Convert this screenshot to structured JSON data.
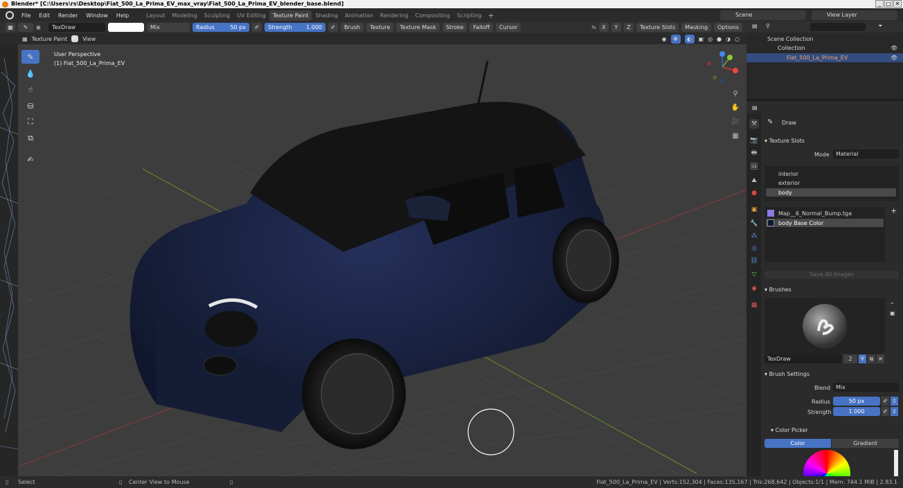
{
  "window": {
    "title": "Blender* [C:\\Users\\rs\\Desktop\\Fiat_500_La_Prima_EV_max_vray\\Fiat_500_La_Prima_EV_blender_base.blend]",
    "controls": [
      "_",
      "□",
      "✕"
    ]
  },
  "menus": [
    "File",
    "Edit",
    "Render",
    "Window",
    "Help"
  ],
  "workspaces": [
    "Layout",
    "Modeling",
    "Sculpting",
    "UV Editing",
    "Texture Paint",
    "Shading",
    "Animation",
    "Rendering",
    "Compositing",
    "Scripting"
  ],
  "active_workspace": "Texture Paint",
  "scene": {
    "name": "Scene",
    "view_layer": "View Layer"
  },
  "tool_header": {
    "brush_name": "TexDraw",
    "blend_mode": "Mix",
    "radius_label": "Radius",
    "radius_value": "50 px",
    "strength_label": "Strength",
    "strength_value": "1.000",
    "menus": [
      "Brush",
      "Texture",
      "Texture Mask",
      "Stroke",
      "Falloff",
      "Cursor"
    ],
    "axes": [
      "X",
      "Y",
      "Z"
    ],
    "right_menus": [
      "Texture Slots",
      "Masking",
      "Options"
    ]
  },
  "viewport_header": {
    "mode": "Texture Paint",
    "view_menu": "View"
  },
  "viewport": {
    "perspective": "User Perspective",
    "object": "(1) Fiat_500_La_Prima_EV",
    "gizmo_axes": [
      "X",
      "Y",
      "Z"
    ]
  },
  "outliner": {
    "items": [
      {
        "label": "Scene Collection",
        "level": 0
      },
      {
        "label": "Collection",
        "level": 1
      },
      {
        "label": "Fiat_500_La_Prima_EV",
        "level": 2
      }
    ]
  },
  "properties": {
    "tool_name": "Draw",
    "texture_slots": {
      "title": "Texture Slots",
      "mode_label": "Mode",
      "mode_value": "Material",
      "materials": [
        "interior",
        "exterior",
        "body"
      ],
      "active_material": "body",
      "images": [
        "Map__6_Normal_Bump.tga",
        "body Base Color"
      ],
      "active_image": "body Base Color",
      "save_button": "Save All Images"
    },
    "brushes": {
      "title": "Brushes",
      "brush_name": "TexDraw",
      "users": "2"
    },
    "brush_settings": {
      "title": "Brush Settings",
      "blend_label": "Blend",
      "blend_value": "Mix",
      "radius_label": "Radius",
      "radius_value": "50 px",
      "strength_label": "Strength",
      "strength_value": "1.000"
    },
    "color_picker": {
      "title": "Color Picker",
      "tabs": [
        "Color",
        "Gradient"
      ],
      "active_tab": "Color"
    }
  },
  "status_bar": {
    "left": "Select",
    "middle": "Center View to Mouse",
    "right": "Fiat_500_La_Prima_EV | Verts:152,304 | Faces:135,167 | Tris:268,642 | Objects:1/1 | Mem: 744.1 MiB | 2.83.1"
  },
  "colors": {
    "accent": "#4673c4",
    "viewport_bg": "#3d3d3d",
    "car_body": "#1a2440",
    "selected_row": "#334d80"
  }
}
